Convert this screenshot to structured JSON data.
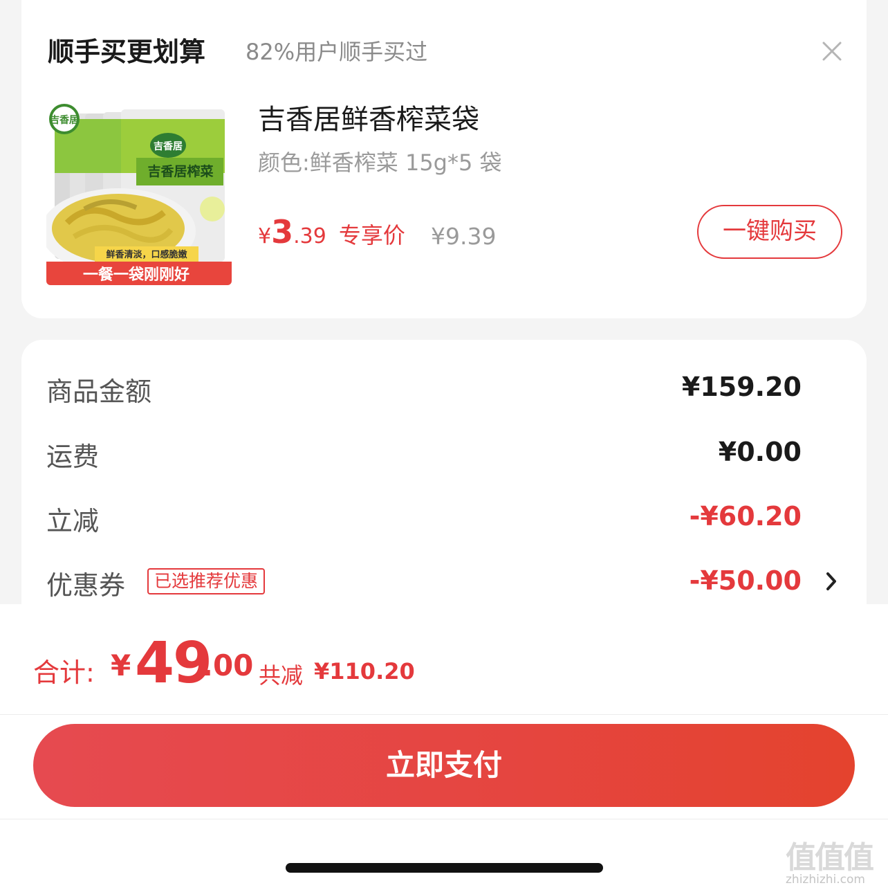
{
  "colors": {
    "accent": "#e4393c",
    "muted": "#9a9a9a",
    "pay_button": "#e5453f"
  },
  "upsell": {
    "title": "顺手买更划算",
    "subtitle": "82%用户顺手买过",
    "close_icon": "close-icon",
    "product": {
      "image_badge_text": "一餐一袋刚刚好",
      "image_caption": "鲜香清淡，口感脆嫩",
      "image_brand": "吉香居",
      "image_pack_label": "吉香居榨菜",
      "name": "吉香居鲜香榨菜袋",
      "spec": "颜色:鲜香榨菜 15g*5 袋",
      "price_symbol": "¥",
      "price_int": "3",
      "price_dec": ".39",
      "price_label": "专享价",
      "original_price": "¥9.39",
      "buy_button": "一键购买"
    }
  },
  "summary": {
    "rows": [
      {
        "label": "商品金额",
        "value": "¥159.20"
      },
      {
        "label": "运费",
        "value": "¥0.00"
      },
      {
        "label": "立减",
        "value": "-¥60.20"
      },
      {
        "label": "优惠券",
        "value": "-¥50.00",
        "badge": "已选推荐优惠",
        "chevron_icon": "chevron-right-icon"
      }
    ]
  },
  "bottom": {
    "total_label": "合计:",
    "total_symbol": "¥",
    "total_int": "49",
    "total_dec": ".00",
    "saved_label": "共减",
    "saved_amount": "¥110.20",
    "pay_button": "立即支付",
    "watermark": "值值值",
    "watermark_url": "zhizhizhi.com"
  }
}
